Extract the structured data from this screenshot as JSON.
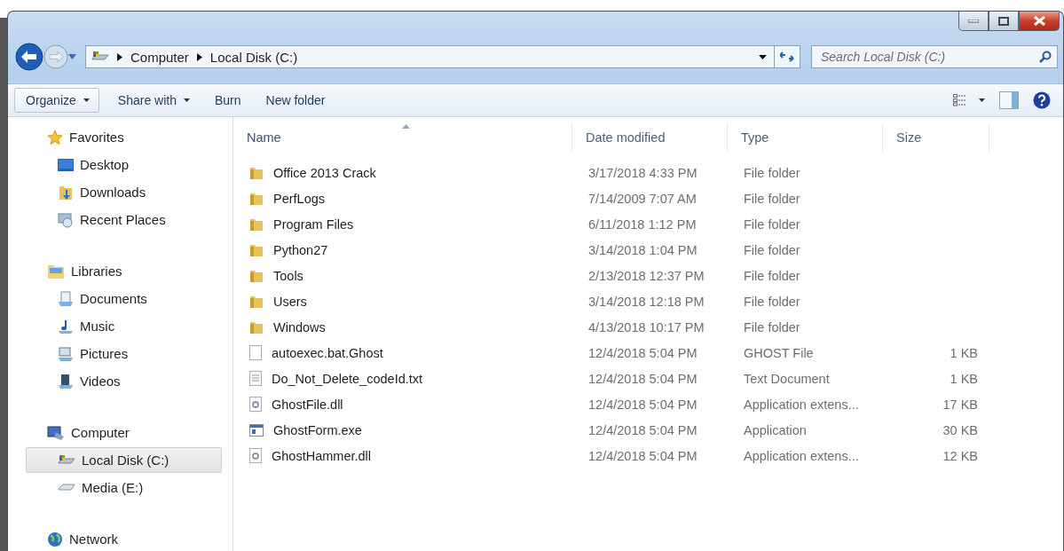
{
  "address_bar": {
    "path": [
      "Computer",
      "Local Disk (C:)"
    ]
  },
  "search": {
    "placeholder": "Search Local Disk (C:)"
  },
  "toolbar": [
    {
      "label": "Organize",
      "dropdown": true
    },
    {
      "label": "Share with",
      "dropdown": true
    },
    {
      "label": "Burn",
      "dropdown": false
    },
    {
      "label": "New folder",
      "dropdown": false
    }
  ],
  "navigation": [
    {
      "label": "Favorites",
      "children": [
        {
          "label": "Desktop",
          "selected": false
        },
        {
          "label": "Downloads",
          "selected": false
        },
        {
          "label": "Recent Places",
          "selected": false
        }
      ]
    },
    {
      "label": "Libraries",
      "children": [
        {
          "label": "Documents",
          "selected": false
        },
        {
          "label": "Music",
          "selected": false
        },
        {
          "label": "Pictures",
          "selected": false
        },
        {
          "label": "Videos",
          "selected": false
        }
      ]
    },
    {
      "label": "Computer",
      "children": [
        {
          "label": "Local Disk (C:)",
          "selected": true
        },
        {
          "label": "Media (E:)",
          "selected": false
        }
      ]
    },
    {
      "label": "Network"
    }
  ],
  "table": {
    "columns": [
      {
        "label": "Name",
        "sorted": true
      },
      {
        "label": "Date modified",
        "sorted": false
      },
      {
        "label": "Type",
        "sorted": false
      },
      {
        "label": "Size",
        "sorted": false
      }
    ],
    "rows": [
      {
        "kind": "folder",
        "name": "Office 2013 Crack",
        "date": "3/17/2018 4:33 PM",
        "type": "File folder"
      },
      {
        "kind": "folder",
        "name": "PerfLogs",
        "date": "7/14/2009 7:07 AM",
        "type": "File folder"
      },
      {
        "kind": "folder",
        "name": "Program Files",
        "date": "6/11/2018 1:12 PM",
        "type": "File folder"
      },
      {
        "kind": "folder",
        "name": "Python27",
        "date": "3/14/2018 1:04 PM",
        "type": "File folder"
      },
      {
        "kind": "folder",
        "name": "Tools",
        "date": "2/13/2018 12:37 PM",
        "type": "File folder"
      },
      {
        "kind": "folder",
        "name": "Users",
        "date": "3/14/2018 12:18 PM",
        "type": "File folder"
      },
      {
        "kind": "folder",
        "name": "Windows",
        "date": "4/13/2018 10:17 PM",
        "type": "File folder"
      },
      {
        "kind": "file",
        "name": "autoexec.bat.Ghost",
        "date": "12/4/2018 5:04 PM",
        "type": "GHOST File",
        "size": "1 KB"
      },
      {
        "kind": "text",
        "name": "Do_Not_Delete_codeId.txt",
        "date": "12/4/2018 5:04 PM",
        "type": "Text Document",
        "size": "1 KB"
      },
      {
        "kind": "dll",
        "name": "GhostFile.dll",
        "date": "12/4/2018 5:04 PM",
        "type": "Application extens...",
        "size": "17 KB"
      },
      {
        "kind": "exe",
        "name": "GhostForm.exe",
        "date": "12/4/2018 5:04 PM",
        "type": "Application",
        "size": "30 KB"
      },
      {
        "kind": "dll",
        "name": "GhostHammer.dll",
        "date": "12/4/2018 5:04 PM",
        "type": "Application extens...",
        "size": "12 KB"
      }
    ]
  }
}
